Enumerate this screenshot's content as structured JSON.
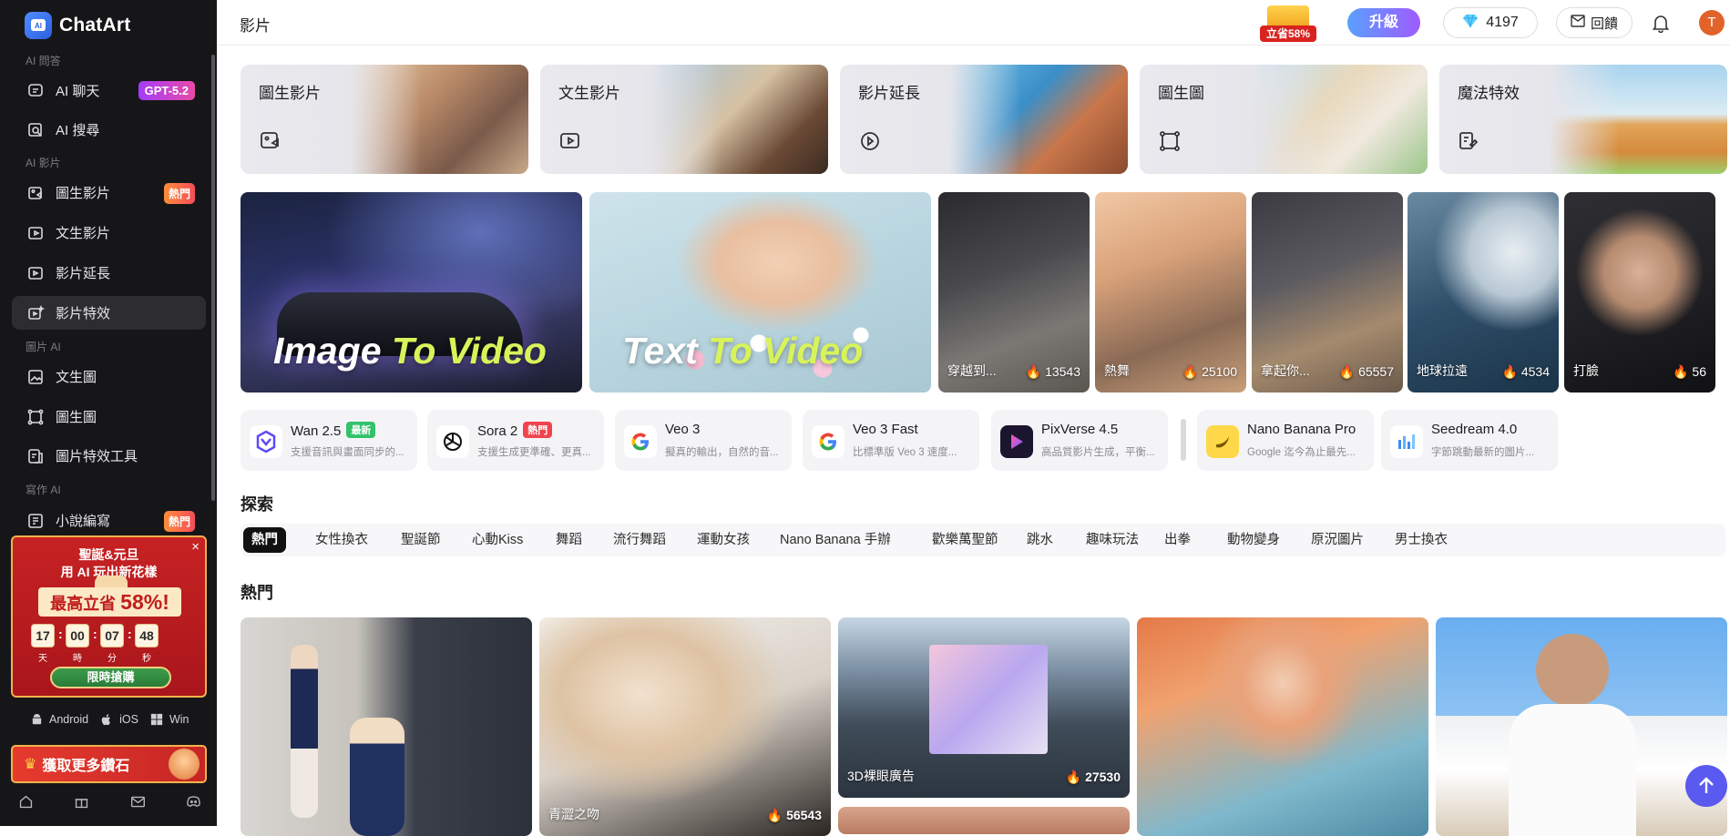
{
  "app": {
    "name": "ChatArt"
  },
  "sidebar": {
    "sections": {
      "ai_chat": "AI 問答",
      "ai_video": "AI 影片",
      "image_ai": "圖片 AI",
      "writing_ai": "寫作 AI"
    },
    "items": [
      {
        "label": "AI 聊天",
        "badge": "GPT-5.2"
      },
      {
        "label": "AI 搜尋"
      },
      {
        "label": "圖生影片",
        "badge": "熱門"
      },
      {
        "label": "文生影片"
      },
      {
        "label": "影片延長"
      },
      {
        "label": "影片特效",
        "active": true
      },
      {
        "label": "文生圖"
      },
      {
        "label": "圖生圖"
      },
      {
        "label": "圖片特效工具"
      },
      {
        "label": "小說編寫",
        "badge": "熱門"
      }
    ],
    "promo": {
      "line1": "聖誕&元旦",
      "line2": "用 AI 玩出新花樣",
      "save_prefix": "最高立省",
      "save_value": "58%!",
      "countdown": [
        {
          "value": "17",
          "unit": "天"
        },
        {
          "value": "00",
          "unit": "時"
        },
        {
          "value": "07",
          "unit": "分"
        },
        {
          "value": "48",
          "unit": "秒"
        }
      ],
      "button": "限時搶購",
      "close": "×"
    },
    "platforms": [
      "Android",
      "iOS",
      "Win"
    ],
    "diamond_cta": "獲取更多鑽石"
  },
  "header": {
    "title": "影片",
    "gift_tag": "立省58%",
    "upgrade": "升級",
    "gems": "4197",
    "feedback": "回饋",
    "avatar": "T"
  },
  "feature_cards": [
    {
      "title": "圖生影片"
    },
    {
      "title": "文生影片"
    },
    {
      "title": "影片延長"
    },
    {
      "title": "圖生圖"
    },
    {
      "title": "魔法特效"
    }
  ],
  "hero": [
    {
      "part1": "Image ",
      "part2": "To Video"
    },
    {
      "part1": "Text ",
      "part2": "To Video"
    }
  ],
  "effect_tiles": [
    {
      "name": "穿越到...",
      "count": "13543"
    },
    {
      "name": "熱舞",
      "count": "25100"
    },
    {
      "name": "拿起你...",
      "count": "65557"
    },
    {
      "name": "地球拉遠",
      "count": "4534"
    },
    {
      "name": "打臉",
      "count": "56"
    }
  ],
  "models": [
    {
      "name": "Wan 2.5",
      "badge": "最新",
      "desc": "支援音訊與畫面同步的..."
    },
    {
      "name": "Sora 2",
      "badge": "熱門",
      "desc": "支援生成更準確、更真..."
    },
    {
      "name": "Veo 3",
      "desc": "擬真的輸出，自然的音..."
    },
    {
      "name": "Veo 3 Fast",
      "desc": "比標準版 Veo 3 速度..."
    },
    {
      "name": "PixVerse 4.5",
      "desc": "高品質影片生成，平衡..."
    },
    {
      "name": "Nano Banana Pro",
      "desc": "Google 迄今為止最先..."
    },
    {
      "name": "Seedream 4.0",
      "desc": "字節跳動最新的圖片..."
    }
  ],
  "explore": {
    "title": "探索",
    "filters": [
      "熱門",
      "女性換衣",
      "聖誕節",
      "心動Kiss",
      "舞蹈",
      "流行舞蹈",
      "運動女孩",
      "Nano Banana 手辦",
      "歡樂萬聖節",
      "跳水",
      "趣味玩法",
      "出拳",
      "動物變身",
      "原況圖片",
      "男士換衣"
    ]
  },
  "hot": {
    "title": "熱門",
    "cards": [
      {
        "name": "",
        "count": ""
      },
      {
        "name": "青澀之吻",
        "count": "56543"
      },
      {
        "name": "3D裸眼廣告",
        "count": "27530"
      },
      {
        "name": "",
        "count": ""
      },
      {
        "name": "",
        "count": ""
      }
    ]
  },
  "colors": {
    "accent": "#5a59f0",
    "sidebar_bg": "#161619",
    "hot": "#f34e5a",
    "gpt_badge": "#a43cf7"
  }
}
